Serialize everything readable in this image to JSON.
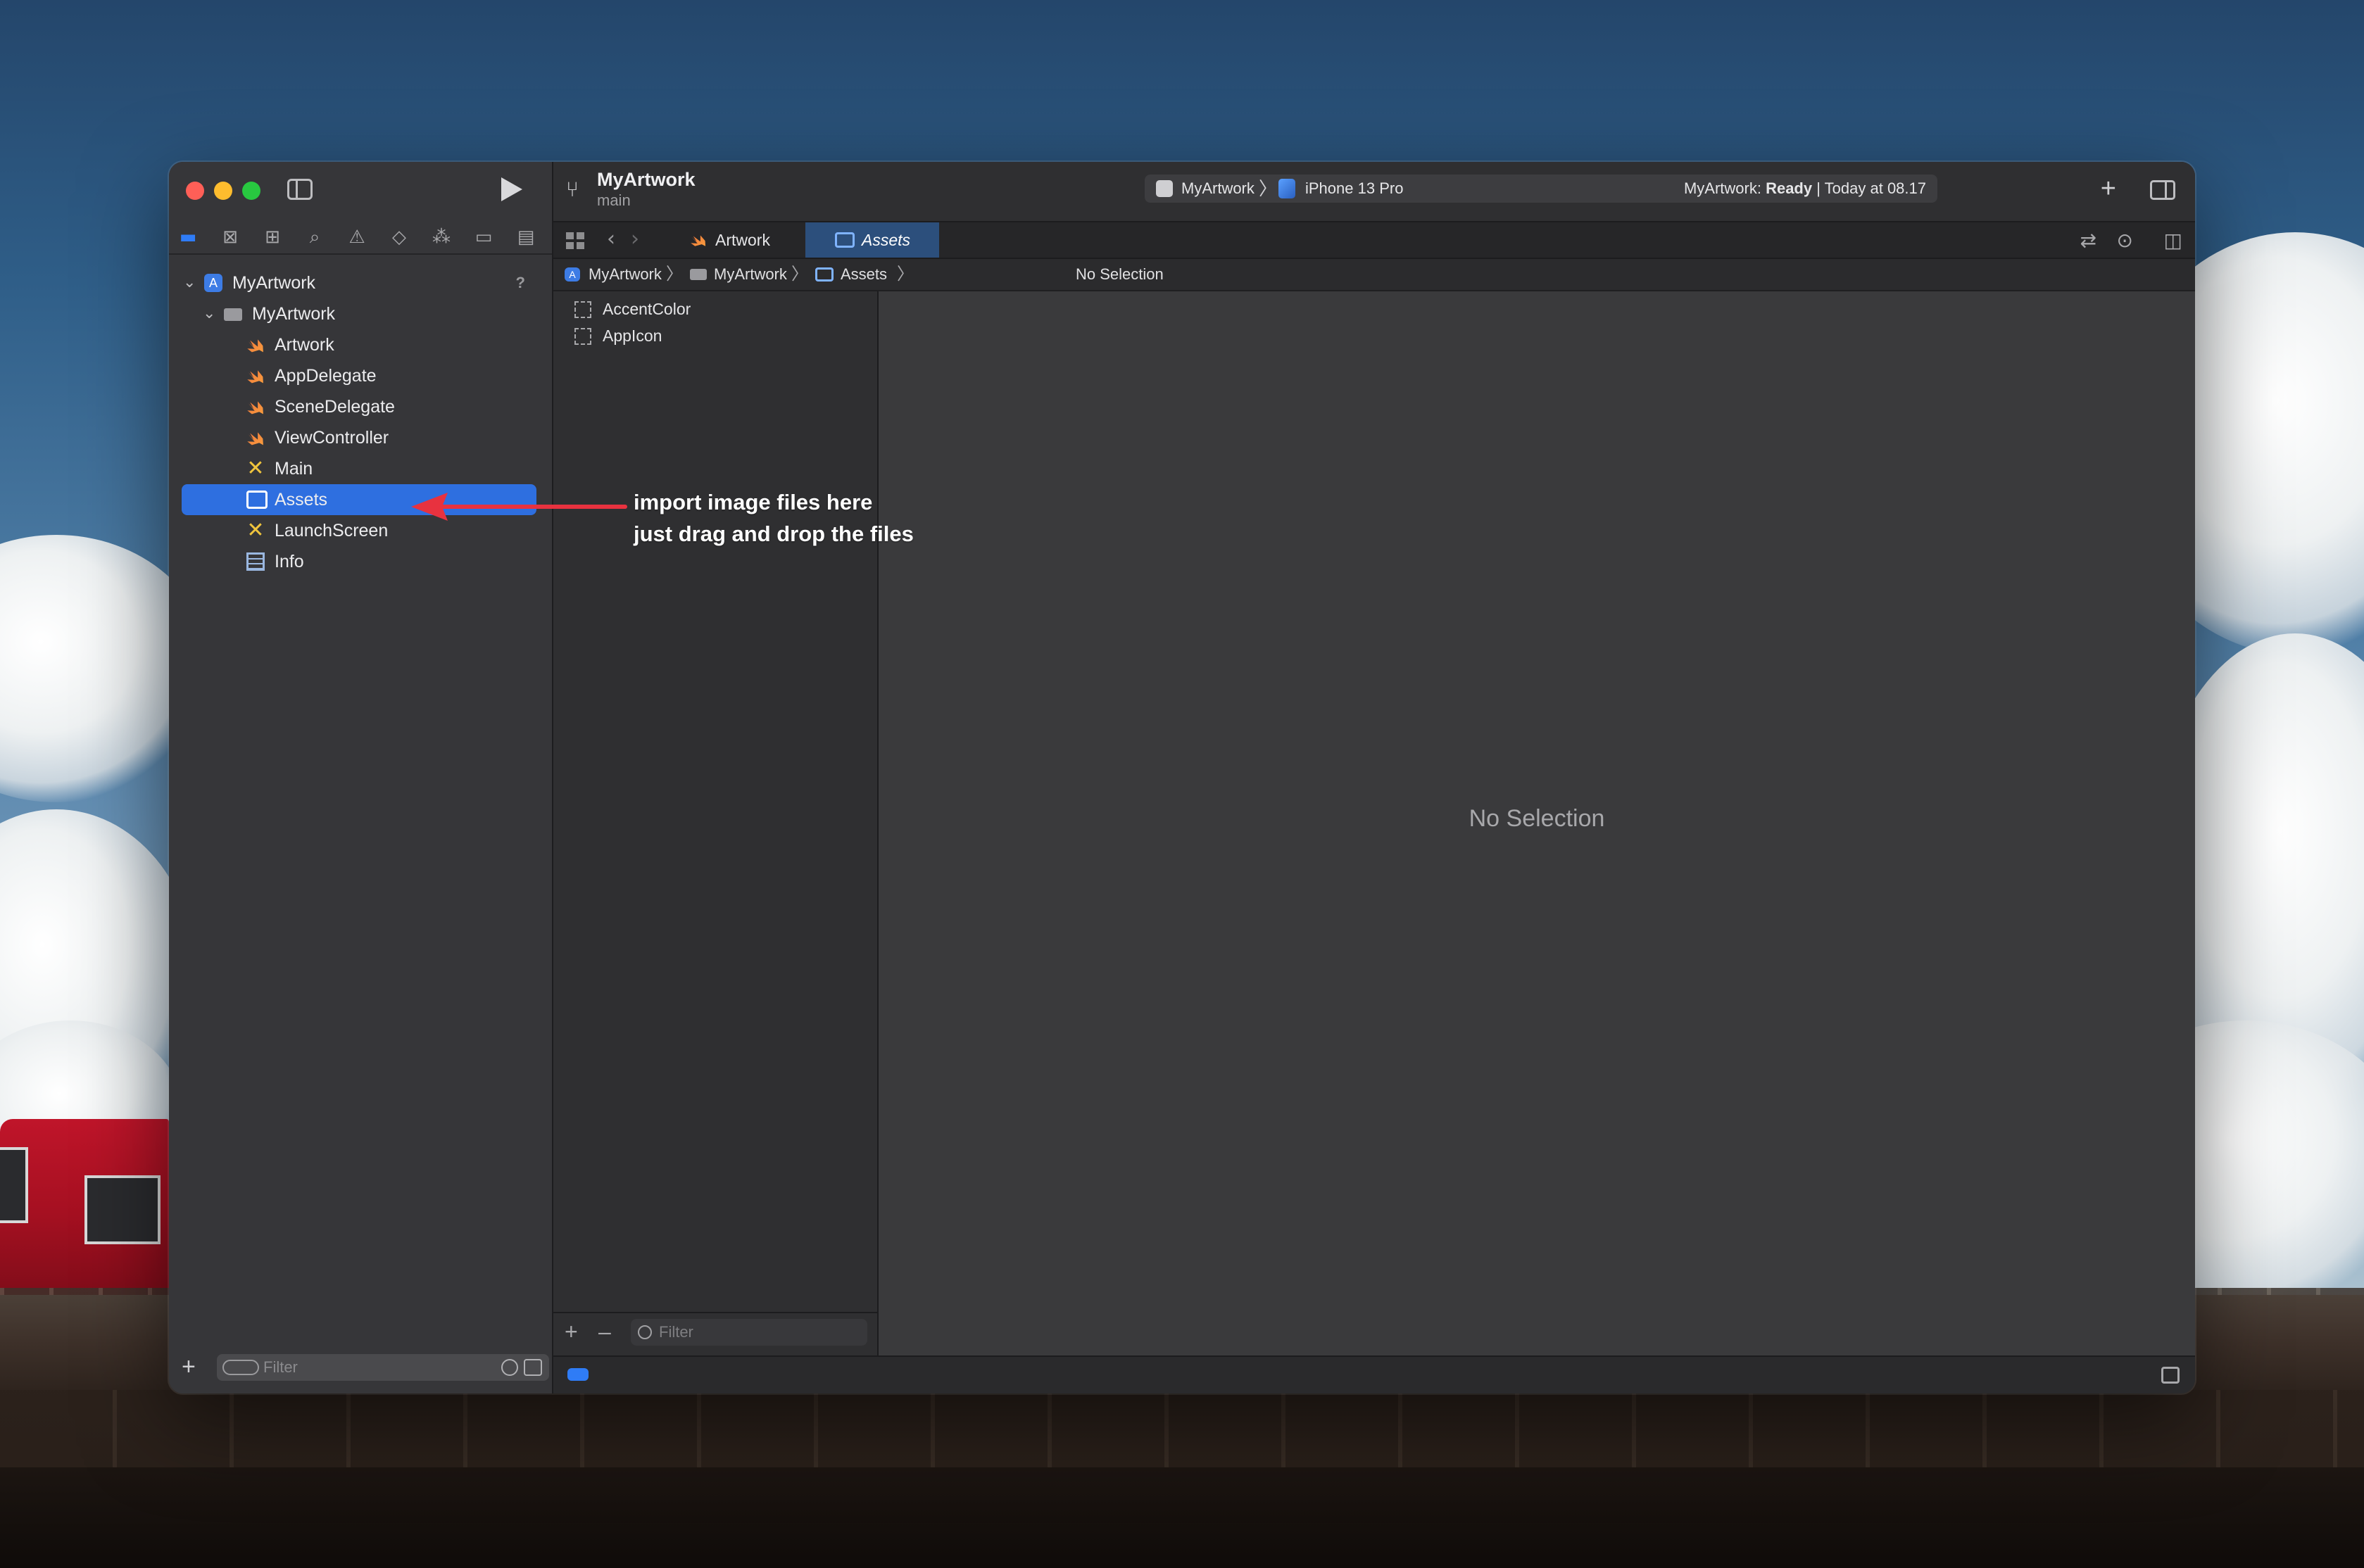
{
  "window": {
    "project_title": "MyArtwork",
    "branch": "main"
  },
  "toolbar": {
    "scheme_app": "MyArtwork",
    "scheme_device": "iPhone 13 Pro",
    "status_prefix": "MyArtwork: ",
    "status_state": "Ready",
    "status_suffix": " | Today at 08.17"
  },
  "tabs": [
    {
      "label": "Artwork",
      "icon": "swift-file-icon",
      "active": false
    },
    {
      "label": "Assets",
      "icon": "asset-catalog-icon",
      "active": true
    }
  ],
  "breadcrumb": [
    "MyArtwork",
    "MyArtwork",
    "Assets",
    "No Selection"
  ],
  "navigator": {
    "tree": [
      {
        "label": "MyArtwork",
        "icon": "project-icon",
        "level": 0,
        "expanded": true,
        "help": "?"
      },
      {
        "label": "MyArtwork",
        "icon": "folder-icon",
        "level": 1,
        "expanded": true
      },
      {
        "label": "Artwork",
        "icon": "swift-file-icon",
        "level": 2
      },
      {
        "label": "AppDelegate",
        "icon": "swift-file-icon",
        "level": 2
      },
      {
        "label": "SceneDelegate",
        "icon": "swift-file-icon",
        "level": 2
      },
      {
        "label": "ViewController",
        "icon": "swift-file-icon",
        "level": 2
      },
      {
        "label": "Main",
        "icon": "storyboard-icon",
        "level": 2
      },
      {
        "label": "Assets",
        "icon": "asset-catalog-icon",
        "level": 2,
        "selected": true
      },
      {
        "label": "LaunchScreen",
        "icon": "storyboard-icon",
        "level": 2
      },
      {
        "label": "Info",
        "icon": "plist-icon",
        "level": 2
      }
    ],
    "filter_placeholder": "Filter"
  },
  "assets": {
    "items": [
      "AccentColor",
      "AppIcon"
    ],
    "filter_placeholder": "Filter"
  },
  "editor": {
    "empty_message": "No Selection"
  },
  "annotation": {
    "line1": "import image files here",
    "line2": "just drag and drop the files",
    "arrow_color": "#e8323f"
  },
  "colors": {
    "selection": "#2e6fe0",
    "active_tab": "#2c4f7c"
  }
}
